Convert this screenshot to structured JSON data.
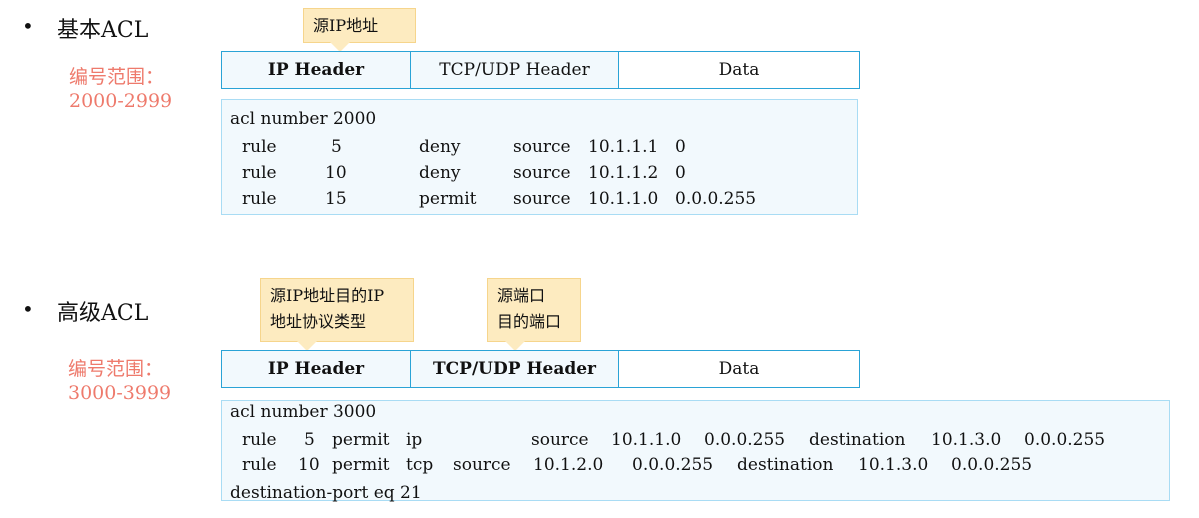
{
  "basic": {
    "bullet": "•",
    "title": "基本ACL",
    "range_label": "编号范围：",
    "range": "2000-2999",
    "callout": "源IP地址",
    "headers": [
      "IP Header",
      "TCP/UDP Header",
      "Data"
    ],
    "code_title": "acl number 2000",
    "rules": [
      [
        "rule",
        "5",
        "deny",
        "source",
        "10.1.1.1",
        "0"
      ],
      [
        "rule",
        "10",
        "deny",
        "source",
        "10.1.1.2",
        "0"
      ],
      [
        "rule",
        "15",
        "permit",
        "source",
        "10.1.1.0",
        "0.0.0.255"
      ]
    ]
  },
  "advanced": {
    "bullet": "•",
    "title": "高级ACL",
    "range_label": "编号范围：",
    "range": "3000-3999",
    "callout_ip": [
      "源IP地址目的IP",
      "地址协议类型"
    ],
    "callout_port": [
      "源端口",
      "目的端口"
    ],
    "headers": [
      "IP Header",
      "TCP/UDP Header",
      "Data"
    ],
    "code_title": "acl number 3000",
    "rules": [
      [
        "rule",
        "5",
        "permit",
        "ip",
        "source",
        "10.1.1.0",
        "0.0.0.255",
        "destination",
        "10.1.3.0",
        "0.0.0.255"
      ],
      [
        "rule",
        "10",
        "permit",
        "tcp",
        "source",
        "10.1.2.0",
        "0.0.0.255",
        "destination",
        "10.1.3.0",
        "0.0.0.255"
      ]
    ],
    "code_tail": "destination-port eq 21"
  }
}
